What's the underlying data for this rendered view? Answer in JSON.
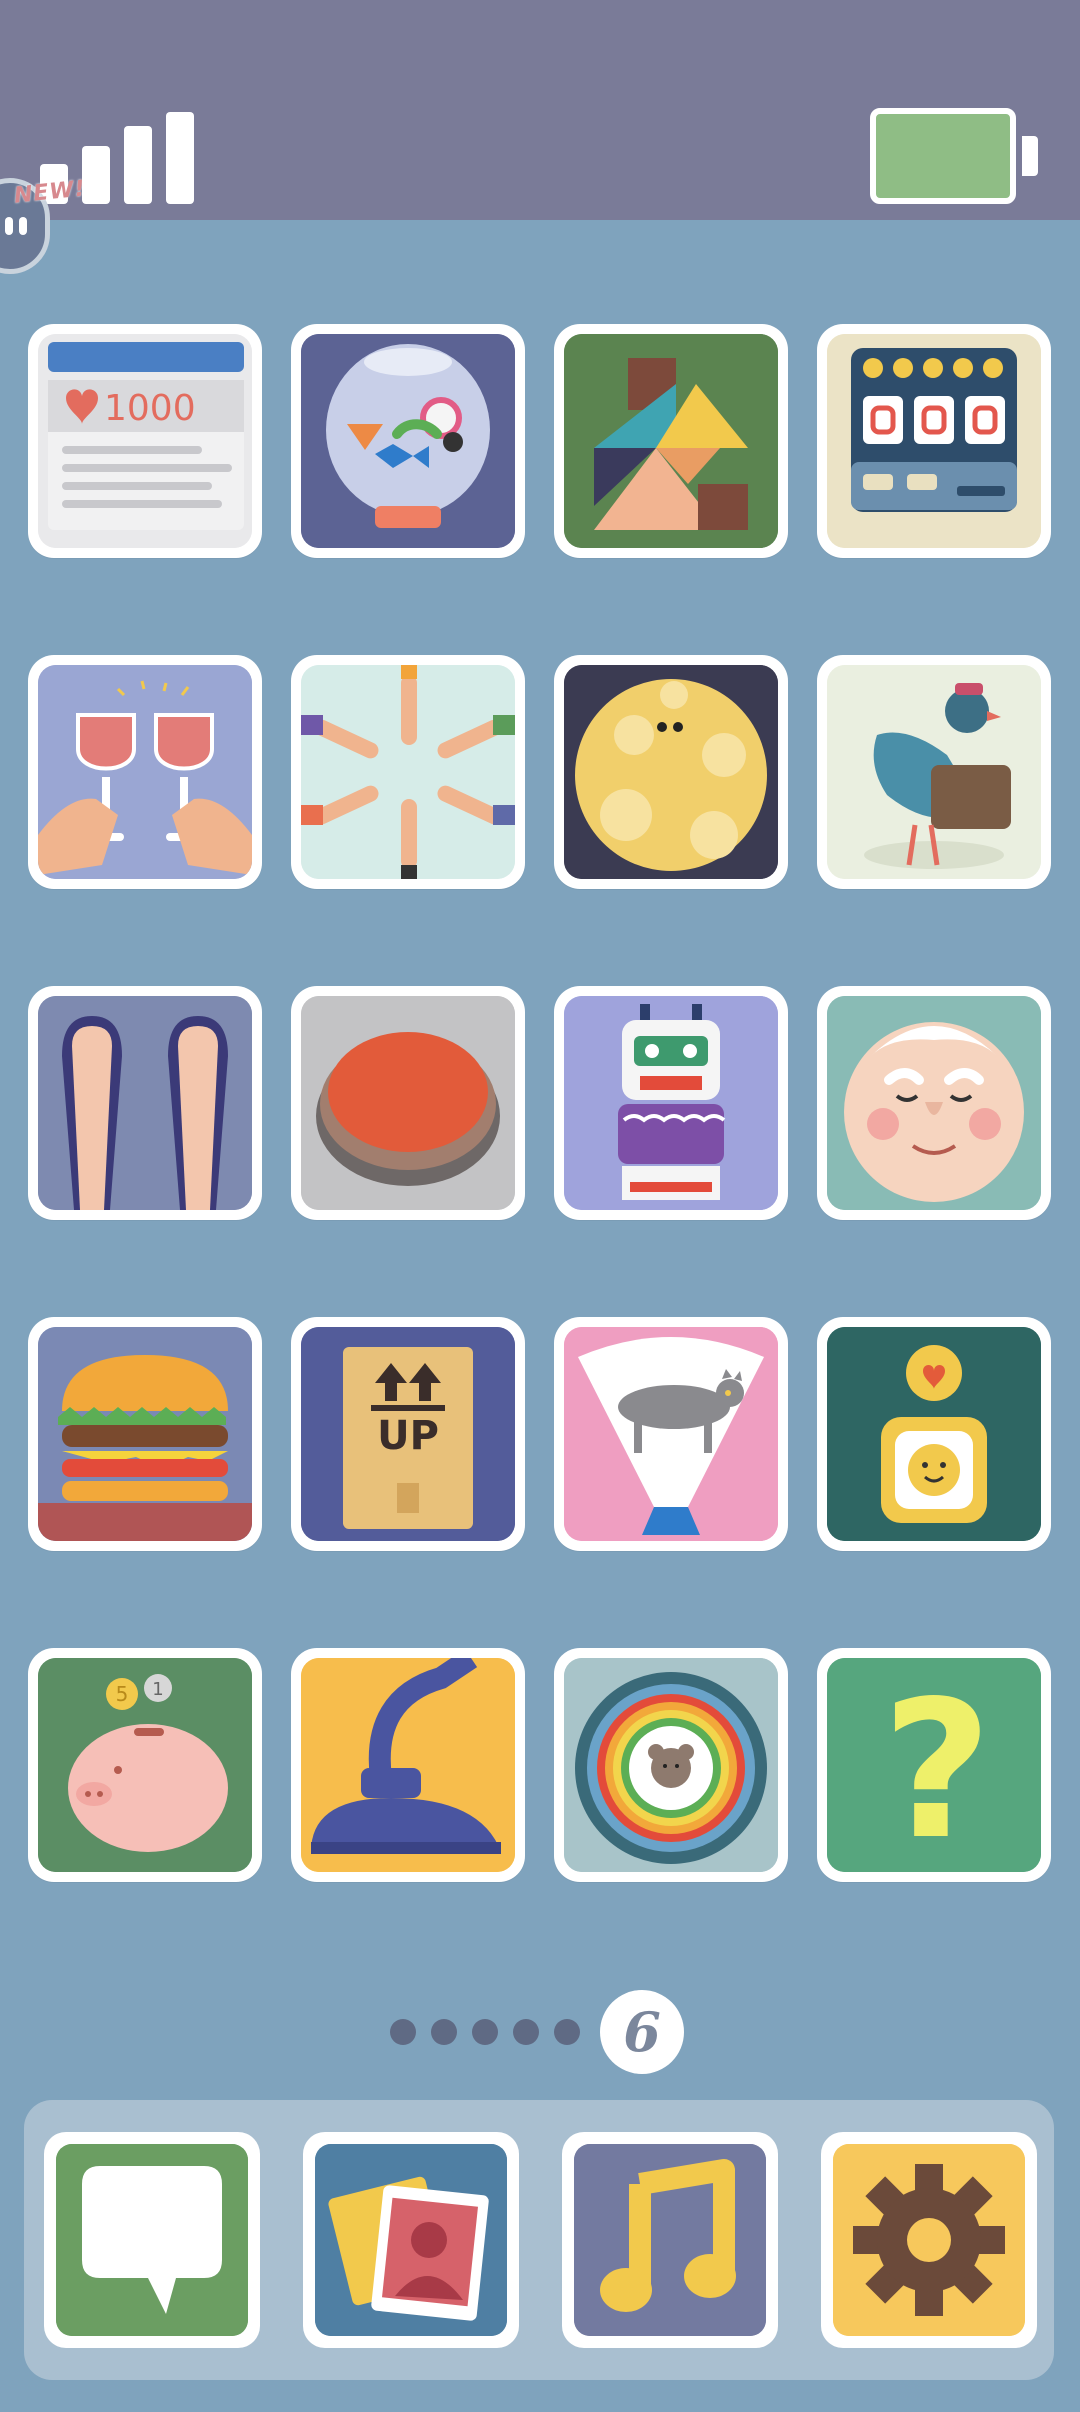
{
  "status_bar": {
    "signal_bars": 4,
    "battery_color": "#8fbd85",
    "badge": "NEW!"
  },
  "grid": {
    "rows": [
      [
        {
          "name": "social-post-app",
          "likes": "1000",
          "icon": "heart-icon"
        },
        {
          "name": "fishbowl-candy-app",
          "icon": "fishbowl-icon"
        },
        {
          "name": "tangram-house-app",
          "icon": "tangram-icon"
        },
        {
          "name": "slot-machine-app",
          "icon": "slot-machine-icon"
        }
      ],
      [
        {
          "name": "toast-glasses-app",
          "icon": "wine-glasses-icon"
        },
        {
          "name": "hands-star-app",
          "icon": "hands-circle-icon"
        },
        {
          "name": "moon-app",
          "icon": "moon-icon"
        },
        {
          "name": "pigeon-mail-app",
          "icon": "pigeon-icon"
        }
      ],
      [
        {
          "name": "flip-flops-app",
          "icon": "flip-flops-icon"
        },
        {
          "name": "red-button-app",
          "icon": "red-button-icon"
        },
        {
          "name": "totem-app",
          "icon": "totem-icon"
        },
        {
          "name": "grandpa-app",
          "icon": "old-man-face-icon"
        }
      ],
      [
        {
          "name": "burger-app",
          "icon": "burger-icon"
        },
        {
          "name": "box-up-app",
          "label": "UP",
          "icon": "box-icon"
        },
        {
          "name": "cat-fan-app",
          "icon": "cat-fan-icon"
        },
        {
          "name": "smile-pendant-app",
          "icon": "pendant-icon"
        }
      ],
      [
        {
          "name": "piggy-bank-app",
          "coins": [
            "5",
            "1"
          ],
          "icon": "piggy-bank-icon"
        },
        {
          "name": "vacuum-app",
          "icon": "vacuum-icon"
        },
        {
          "name": "target-bear-app",
          "icon": "target-icon"
        },
        {
          "name": "mystery-app",
          "label": "?",
          "icon": "question-icon"
        }
      ]
    ]
  },
  "pager": {
    "dots": 5,
    "current_page": "6"
  },
  "dock": [
    {
      "name": "messages",
      "icon": "speech-bubble-icon"
    },
    {
      "name": "photos",
      "icon": "photos-icon"
    },
    {
      "name": "music",
      "icon": "music-note-icon"
    },
    {
      "name": "settings",
      "icon": "gear-icon"
    }
  ]
}
